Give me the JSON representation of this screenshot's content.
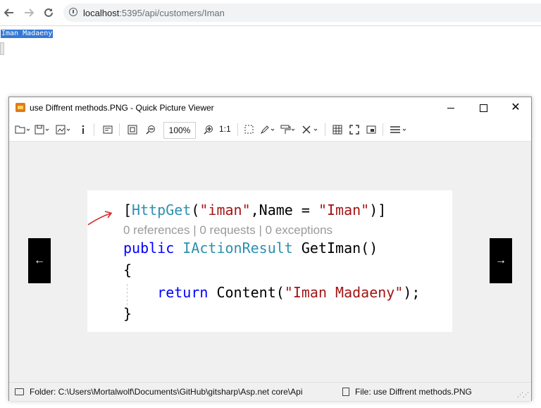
{
  "browser": {
    "url_host": "localhost",
    "url_path": ":5395/api/customers/Iman",
    "back_icon": "arrow-left-icon",
    "forward_icon": "arrow-right-icon",
    "reload_icon": "reload-icon"
  },
  "page": {
    "response_text": "Iman Madaeny"
  },
  "viewer": {
    "title": "use Diffrent methods.PNG - Quick Picture Viewer",
    "zoom": "100%",
    "ratio": "1:1",
    "prev_label": "←",
    "next_label": "→",
    "code": {
      "l1_open": "[",
      "l1_attr": "HttpGet",
      "l1_p1": "(",
      "l1_s1": "\"iman\"",
      "l1_mid": ",Name = ",
      "l1_s2": "\"Iman\"",
      "l1_close": ")]",
      "l2_refs": "0 references | 0 requests | 0 exceptions",
      "l3_kw": "public",
      "l3_type": "IActionResult",
      "l3_rest": " GetIman()",
      "l4": "{",
      "l5_kw": "return",
      "l5_mid": " Content(",
      "l5_str": "\"Iman Madaeny\"",
      "l5_end": ");",
      "l6": "}"
    },
    "status": {
      "folder": "Folder: C:\\Users\\Mortalwolf\\Documents\\GitHub\\gitsharp\\Asp.net core\\Api",
      "file": "File: use Diffrent methods.PNG"
    }
  }
}
